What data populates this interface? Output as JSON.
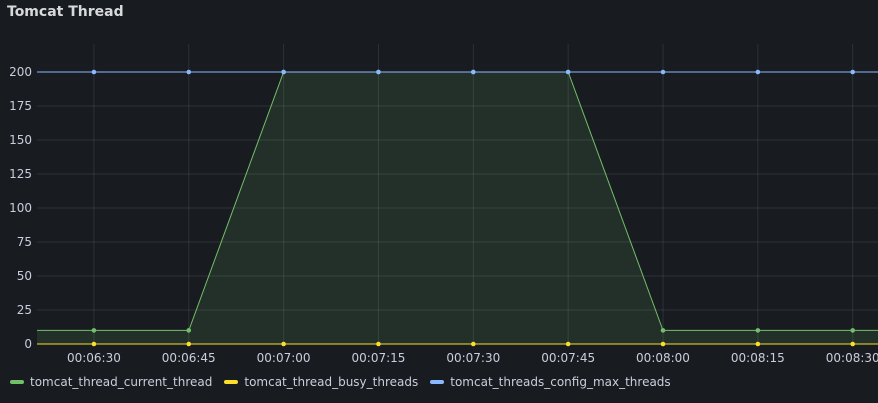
{
  "panel": {
    "title": "Tomcat Thread"
  },
  "chart_data": {
    "type": "line",
    "x": [
      "00:06:30",
      "00:06:45",
      "00:07:00",
      "00:07:15",
      "00:07:30",
      "00:07:45",
      "00:08:00",
      "00:08:15",
      "00:08:30"
    ],
    "x_seconds": [
      390,
      405,
      420,
      435,
      450,
      465,
      480,
      495,
      510
    ],
    "x_range_seconds": [
      381,
      514
    ],
    "ylim": [
      0,
      200
    ],
    "yticks": [
      0,
      25,
      50,
      75,
      100,
      125,
      150,
      175,
      200
    ],
    "grid": true,
    "legend_position": "bottom-left",
    "series": [
      {
        "name": "tomcat_thread_current_thread",
        "color": "#73bf69",
        "fill": true,
        "values": [
          10,
          10,
          200,
          200,
          200,
          200,
          10,
          10,
          10
        ]
      },
      {
        "name": "tomcat_thread_busy_threads",
        "color": "#fade2a",
        "fill": false,
        "values": [
          0,
          0,
          0,
          0,
          0,
          0,
          0,
          0,
          0
        ]
      },
      {
        "name": "tomcat_threads_config_max_threads",
        "color": "#8ab8ff",
        "fill": false,
        "values": [
          200,
          200,
          200,
          200,
          200,
          200,
          200,
          200,
          200
        ]
      }
    ]
  }
}
